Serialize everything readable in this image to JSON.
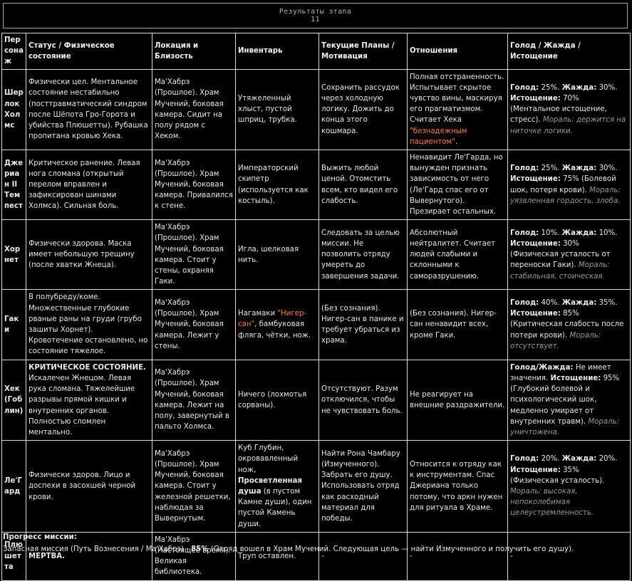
{
  "header": {
    "title": "Результаты этапа",
    "stage": "11"
  },
  "columns": [
    "Персонаж",
    "Статус / Физическое состояние",
    "Локация и Близость",
    "Инвентарь",
    "Текущие Планы / Мотивация",
    "Отношения",
    "Голод / Жажда / Истощение"
  ],
  "rows": [
    {
      "name": "Шерлок Холмс",
      "status": "Физически цел. Ментальное состояние нестабильно (посттравматический синдром после Шёпота Гро-Горота и убийства Плюшетты). Рубашка пропитана кровью Хека.",
      "location": "Ма'Хабрэ (Прошлое). Храм Мучений, боковая камера. Сидит на полу рядом с Хеком.",
      "inventory_pre": "Утяжеленный хлыст, пустой шприц, трубка.",
      "plans": "Сохранить рассудок через холодную логику. Дожить до конца этого кошмара.",
      "relations_pre": "Полная отстраненность. Испытывает скрытое чувство вины, маскируя его прагматизмом. Считает Хека ",
      "relations_hl": "\"безнадежным пациентом\"",
      "relations_post": ".",
      "hunger_label": "Голод:",
      "hunger": "25%.",
      "thirst_label": "Жажда:",
      "thirst": "30%.",
      "exh_label": "Истощение:",
      "exh": "70% (Ментальное истощение, стресс).",
      "moral": "Мораль: держится на ниточке логики."
    },
    {
      "name": "Джериан II Темпест",
      "status": "Критическое ранение. Левая нога сломана (открытый перелом вправлен и зафиксирован шинами Холмса). Сильная боль.",
      "location": "Ма'Хабрэ (Прошлое). Храм Мучений, боковая камера. Привалился к стене.",
      "inventory_pre": "Императорский скипетр (используется как костыль).",
      "plans": "Выжить любой ценой. Отомстить всем, кто видел его слабость.",
      "relations_pre": "Ненавидит Ле'Гарда, но вынужден признать зависимость от него (Ле'Гард спас его от Вывернутого). Презирает остальных.",
      "hunger_label": "Голод:",
      "hunger": "25%.",
      "thirst_label": "Жажда:",
      "thirst": "30%.",
      "exh_label": "Истощение:",
      "exh": "75% (Болевой шок, потеря крови).",
      "moral": "Мораль: уязвленная гордость, злоба."
    },
    {
      "name": "Хорнет",
      "status": "Физически здорова. Маска имеет небольшую трещину (после хватки Жнеца).",
      "location": "Ма'Хабрэ (Прошлое). Храм Мучений, боковая камера. Стоит у стены, охраняя Гаки.",
      "inventory_pre": "Игла, шелковая нить.",
      "plans": "Следовать за целью миссии. Не позволить отряду умереть до завершения задачи.",
      "relations_pre": "Абсолютный нейтралитет. Считает людей слабыми и склонными к саморазрушению.",
      "hunger_label": "Голод:",
      "hunger": "10%.",
      "thirst_label": "Жажда:",
      "thirst": "10%.",
      "exh_label": "Истощение:",
      "exh": "30% (Физическая усталость от переноски Гаки).",
      "moral": "Мораль: стабильная, стоическая."
    },
    {
      "name": "Гаки",
      "status": "В полубреду/коме. Множественные глубокие рваные раны на груди (грубо зашиты Хорнет). Кровотечение остановлено, но состояние тяжелое.",
      "location": "Ма'Хабрэ (Прошлое). Храм Мучений, боковая камера. Лежит у стены.",
      "inventory_pre": "Нагамаки ",
      "inventory_hl": "\"Нигер-сан\"",
      "inventory_post": ", бамбуковая фляга, чётки, нож.",
      "plans": "(Без сознания). Нигер-сан в панике и требует убраться из храма.",
      "relations_pre": "(Без сознания). Нигер-сан ненавидит всех, кроме Гаки.",
      "hunger_label": "Голод:",
      "hunger": "40%.",
      "thirst_label": "Жажда:",
      "thirst": "35%.",
      "exh_label": "Истощение:",
      "exh": "85% (Критическая слабость после потери крови).",
      "moral": "Мораль: отсутствует."
    },
    {
      "name": "Хек (Гоблин)",
      "status_bold": "КРИТИЧЕСКОЕ СОСТОЯНИЕ.",
      "status": "Искалечен Жнецом. Левая рука сломана. Тяжелейшие разрывы прямой кишки и внутренних органов. Полностью сломлен ментально.",
      "location": "Ма'Хабрэ (Прошлое). Храм Мучений, боковая камера. Лежит на полу, завернутый в пальто Холмса.",
      "inventory_pre": "Ничего (лохмотья сорваны).",
      "plans": "Отсутствуют. Разум отключился, чтобы не чувствовать боль.",
      "relations_pre": "Не реагирует на внешние раздражители.",
      "hunger_label": "Голод/Жажда:",
      "hunger": "Не имеет значения.",
      "exh_label": "Истощение:",
      "exh": "95% (Глубокий болевой и психологический шок, медленно умирает от внутренних травм).",
      "moral": "Мораль: уничтожена."
    },
    {
      "name": "Ле'Гард",
      "status": "Физически здоров. Лицо и доспехи в засохшей черной крови.",
      "location": "Ма'Хабрэ (Прошлое). Храм Мучений, боковая камера. Стоит у железной решетки, наблюдая за Вывернутым.",
      "inventory_pre": "Куб Глубин, окровавленный нож, ",
      "inventory_bold": "Просветленная душа",
      "inventory_post": " (в пустом Камне души), один пустой Камень души.",
      "plans": "Найти Рона Чамбару (Измученного). Забрать его душу. Использовать отряд как расходный материал для победы.",
      "relations_pre": "Относится к отряду как к инструментам. Спас Джериана только потому, что аркн нужен для ритуала в Храме.",
      "hunger_label": "Голод:",
      "hunger": "20%.",
      "thirst_label": "Жажда:",
      "thirst": "20%.",
      "exh_label": "Истощение:",
      "exh": "35% (Физическая усталость).",
      "moral": "Мораль: высокая, непоколебимая целеустремленность."
    },
    {
      "name": "Плюшетта",
      "status_bold": "МЕРТВА.",
      "location": "Ма'Хабрэ (Настоящее время). Великая библиотека.",
      "inventory_pre": "Труп оставлен.",
      "plans": "-",
      "relations_pre": "-",
      "dash": "-"
    }
  ],
  "footer": {
    "title": "Прогресс миссии:",
    "line_pre": "Запасная миссия (Путь Вознесения / Ма'Хабрэ) - ",
    "pct": "85%",
    "line_post": " (Отряд вошел в Храм Мучений. Следующая цель — найти Измученного и получить его душу)."
  }
}
